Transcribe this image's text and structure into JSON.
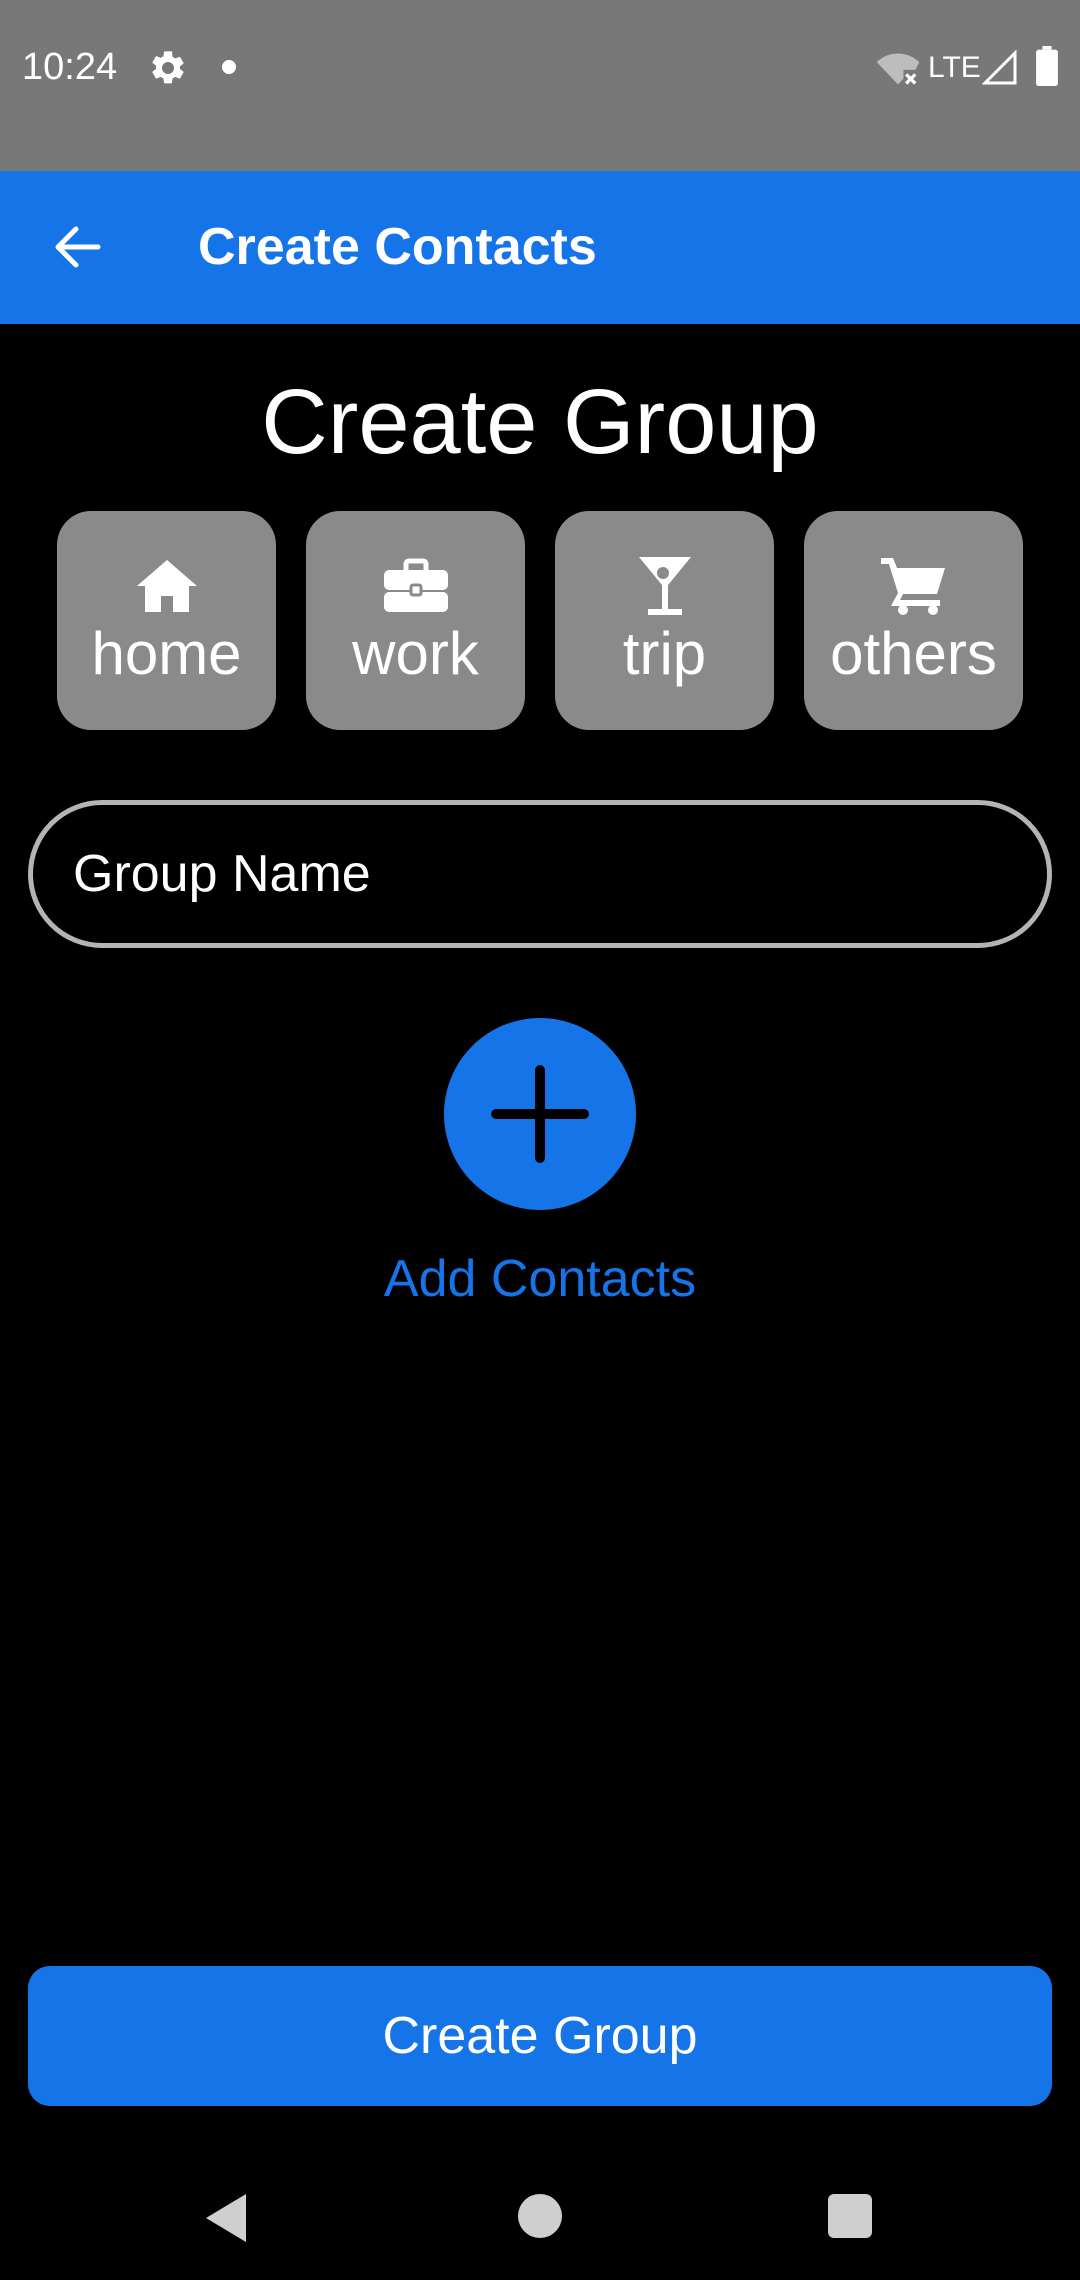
{
  "status_bar": {
    "time": "10:24",
    "network": "LTE",
    "icons": [
      "gear-icon",
      "notification-dot-icon",
      "wifi-off-icon",
      "signal-icon",
      "battery-icon"
    ]
  },
  "app_bar": {
    "title": "Create Contacts",
    "back_icon": "arrow-left-icon"
  },
  "heading": "Create Group",
  "categories": [
    {
      "label": "home",
      "icon": "house-icon"
    },
    {
      "label": "work",
      "icon": "briefcase-icon"
    },
    {
      "label": "trip",
      "icon": "cocktail-glass-icon"
    },
    {
      "label": "others",
      "icon": "shopping-cart-icon"
    }
  ],
  "group_name": {
    "value": "",
    "placeholder": "Group Name"
  },
  "add_contacts": {
    "label": "Add Contacts",
    "icon": "plus-icon"
  },
  "create_button": {
    "label": "Create Group"
  },
  "colors": {
    "accent": "#1474e8",
    "status_bar": "#787878",
    "tile": "#8a8a8a",
    "background": "#000000"
  }
}
